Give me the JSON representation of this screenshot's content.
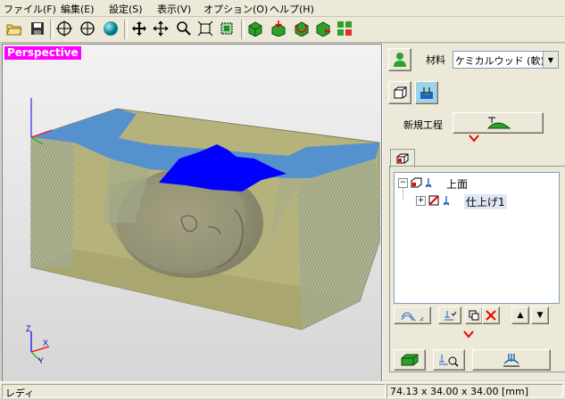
{
  "menu": [
    "ファイル(F)",
    "編集(E)",
    "設定(S)",
    "表示(V)",
    "オプション(O)",
    "ヘルプ(H)"
  ],
  "toolbar": {
    "icons": [
      "open-folder-icon",
      "save-disk-icon",
      "crosshair-icon",
      "circle-cross-icon",
      "sphere-icon",
      "move-arrows-icon",
      "pan-icon",
      "zoom-icon",
      "fit-icon",
      "select-box-icon",
      "view-green-box-icon",
      "view-down-icon",
      "view-rotate-icon",
      "view-reset-icon",
      "view-grid-icon"
    ]
  },
  "viewport": {
    "mode_label": "Perspective",
    "axis_labels": {
      "z": "Z",
      "x": "X",
      "y": "Y"
    },
    "colors": {
      "stock": "#b5b27c",
      "top": "#4f8fd2",
      "toolpath": "#0000ff",
      "model": "#8b8b73"
    }
  },
  "panel": {
    "material_label": "材料",
    "material_value": "ケミカルウッド (軟)",
    "new_process_label": "新規工程",
    "tree": {
      "root_label": "上面",
      "child_label": "仕上げ1",
      "expand_root": "−",
      "expand_child": "+"
    },
    "arrow_glyph": "▲",
    "arrow_down_glyph": "▼"
  },
  "status": {
    "left": "レディ",
    "right": "74.13 x 34.00 x 34.00 [mm]"
  }
}
